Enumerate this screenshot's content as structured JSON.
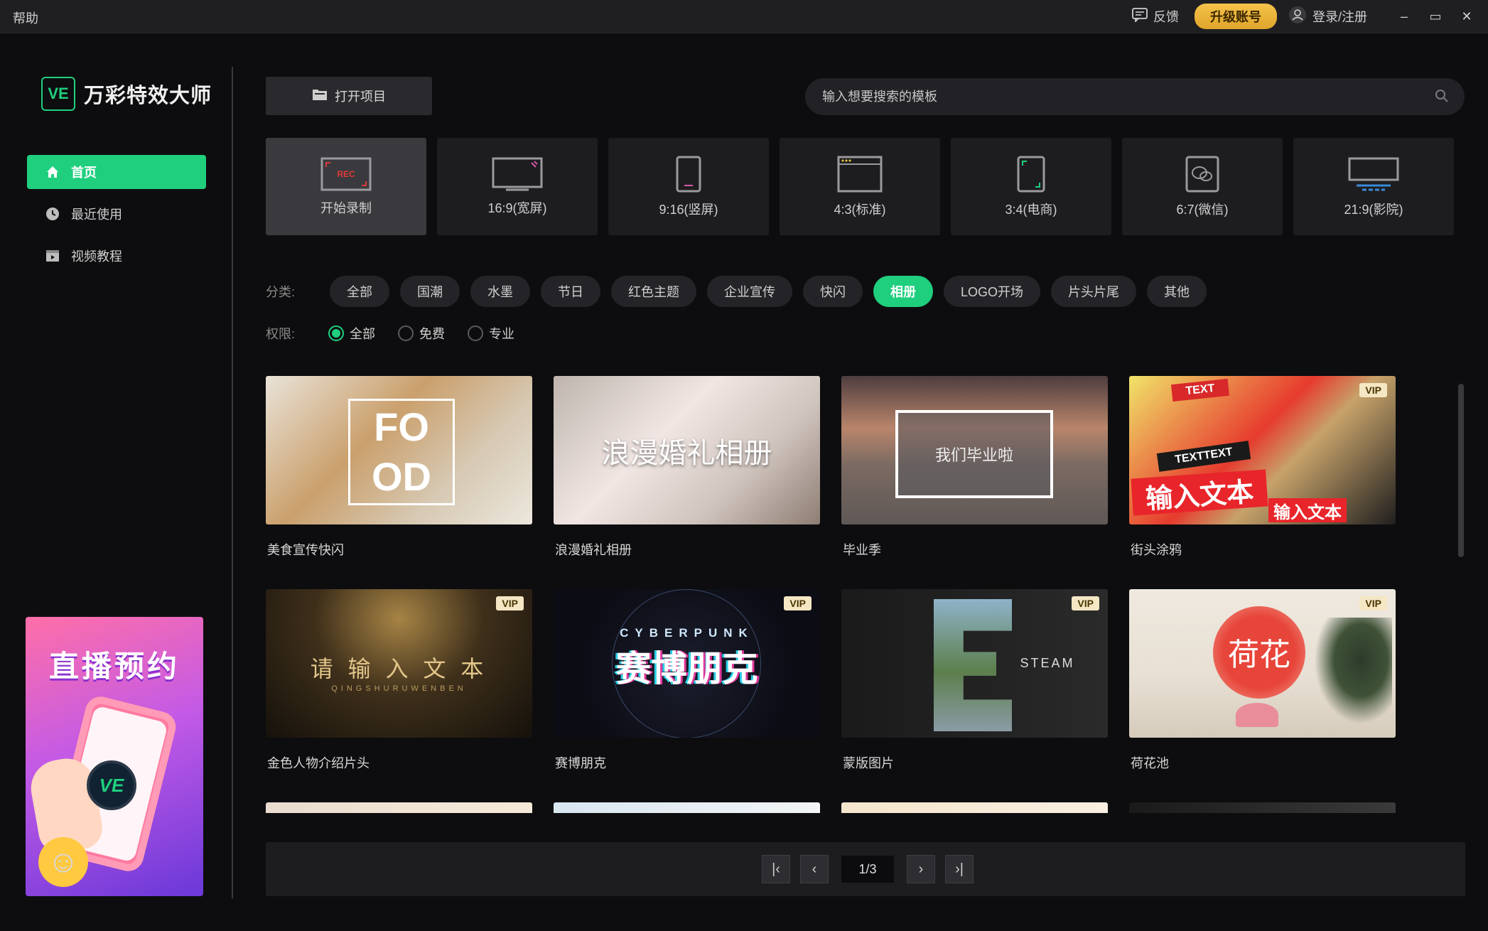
{
  "titlebar": {
    "help": "帮助",
    "feedback": "反馈",
    "upgrade": "升级账号",
    "login": "登录/注册",
    "minimize": "–",
    "maximize": "▭",
    "close": "✕"
  },
  "logo": {
    "badge": "VE",
    "name": "万彩特效大师"
  },
  "nav": [
    {
      "label": "首页",
      "icon": "home-icon",
      "active": true
    },
    {
      "label": "最近使用",
      "icon": "clock-icon",
      "active": false
    },
    {
      "label": "视频教程",
      "icon": "video-icon",
      "active": false
    }
  ],
  "promo": {
    "title": "直播预约",
    "badge": "VE"
  },
  "open_project": "打开项目",
  "search": {
    "placeholder": "输入想要搜索的模板"
  },
  "ratios": [
    {
      "label": "开始录制",
      "icon": "rec-icon"
    },
    {
      "label": "16:9(宽屏)",
      "icon": "widescreen-icon"
    },
    {
      "label": "9:16(竖屏)",
      "icon": "portrait-icon"
    },
    {
      "label": "4:3(标准)",
      "icon": "standard-icon"
    },
    {
      "label": "3:4(电商)",
      "icon": "ecommerce-icon"
    },
    {
      "label": "6:7(微信)",
      "icon": "wechat-icon"
    },
    {
      "label": "21:9(影院)",
      "icon": "cinema-icon"
    }
  ],
  "filters": {
    "category_label": "分类:",
    "categories": [
      "全部",
      "国潮",
      "水墨",
      "节日",
      "红色主题",
      "企业宣传",
      "快闪",
      "相册",
      "LOGO开场",
      "片头片尾",
      "其他"
    ],
    "active_category": "相册",
    "permission_label": "权限:",
    "permissions": [
      "全部",
      "免费",
      "专业"
    ],
    "active_permission": "全部"
  },
  "templates": [
    {
      "title": "美食宣传快闪",
      "overlay": "FO OD",
      "vip": ""
    },
    {
      "title": "浪漫婚礼相册",
      "overlay": "浪漫婚礼相册",
      "vip": ""
    },
    {
      "title": "毕业季",
      "overlay": "我们毕业啦",
      "vip": ""
    },
    {
      "title": "街头涂鸦",
      "overlay": "输入文本",
      "vip": "VIP"
    },
    {
      "title": "金色人物介绍片头",
      "overlay": "请 输 入 文 本",
      "vip": "VIP"
    },
    {
      "title": "赛博朋克",
      "overlay": "赛博朋克",
      "vip": "VIP"
    },
    {
      "title": "蒙版图片",
      "overlay": "STEAM",
      "vip": "VIP"
    },
    {
      "title": "荷花池",
      "overlay": "荷花",
      "vip": "VIP"
    }
  ],
  "overlay_sub": {
    "gold": "QINGSHURUWENBEN",
    "cyber": "CYBERPUNK",
    "graffiti_small": "输入文本",
    "graffiti_tag1": "TEXT",
    "graffiti_tag2": "TEXTTEXT"
  },
  "pagination": {
    "first": "|‹",
    "prev": "‹",
    "page": "1/3",
    "next": "›",
    "last": "›|"
  }
}
